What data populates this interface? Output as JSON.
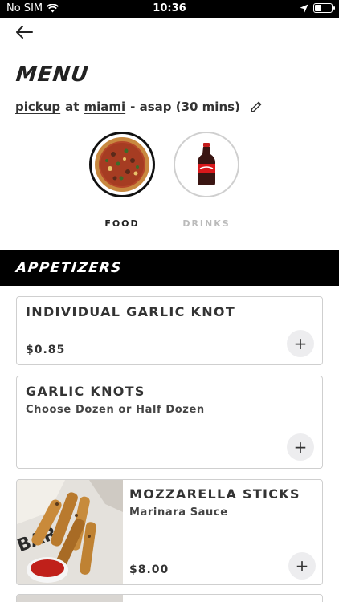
{
  "status_bar": {
    "carrier": "No SIM",
    "time": "10:36",
    "battery_level": 0.35,
    "icons": [
      "wifi-icon",
      "location-arrow-icon",
      "battery-icon"
    ]
  },
  "header": {
    "back_icon": "arrow-left-icon",
    "title": "MENU"
  },
  "order": {
    "mode": "pickup",
    "at_text": "at",
    "location": "miami",
    "timing": "- asap (30 mins)",
    "edit_icon": "pencil-icon"
  },
  "categories": [
    {
      "label": "FOOD",
      "active": true,
      "icon": "pizza-icon"
    },
    {
      "label": "DRINKS",
      "active": false,
      "icon": "soda-bottle-icon"
    }
  ],
  "section": {
    "title": "APPETIZERS"
  },
  "items": [
    {
      "name": "INDIVIDUAL GARLIC KNOT",
      "description": "",
      "price": "$0.85",
      "add_label": "+"
    },
    {
      "name": "GARLIC KNOTS",
      "description": "Choose Dozen or Half Dozen",
      "price": "",
      "add_label": "+"
    },
    {
      "name": "MOZZARELLA STICKS",
      "description": "Marinara Sauce",
      "price": "$8.00",
      "add_label": "+"
    }
  ],
  "colors": {
    "accent": "#000000",
    "card_border": "#cfcfcf",
    "add_button_bg": "#ededef",
    "inactive_label": "#bbbbbb"
  }
}
